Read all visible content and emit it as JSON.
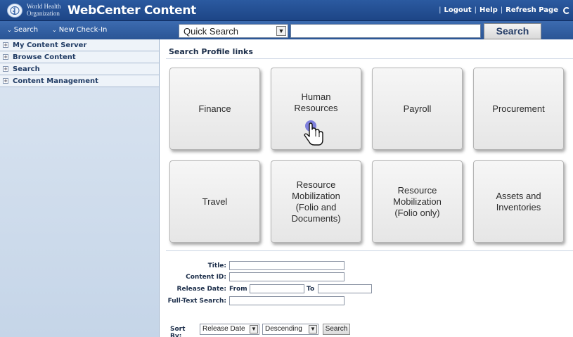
{
  "header": {
    "org_name": "World Health Organization",
    "app_title": "WebCenter Content",
    "links": [
      "Logout",
      "Help",
      "Refresh Page"
    ]
  },
  "toolbar": {
    "search_link": "Search",
    "new_checkin_link": "New Check-In",
    "quick_search_selected": "Quick Search",
    "search_input_value": "",
    "search_button": "Search"
  },
  "sidebar": {
    "items": [
      {
        "label": "My Content Server"
      },
      {
        "label": "Browse Content"
      },
      {
        "label": "Search"
      },
      {
        "label": "Content Management"
      }
    ]
  },
  "main": {
    "heading": "Search Profile links",
    "tiles": [
      {
        "lines": [
          "Finance"
        ]
      },
      {
        "lines": [
          "Human",
          "Resources"
        ]
      },
      {
        "lines": [
          "Payroll"
        ]
      },
      {
        "lines": [
          "Procurement"
        ]
      },
      {
        "lines": [
          "Travel"
        ]
      },
      {
        "lines": [
          "Resource",
          "Mobilization",
          "(Folio and",
          "Documents)"
        ]
      },
      {
        "lines": [
          "Resource",
          "Mobilization",
          "(Folio only)"
        ]
      },
      {
        "lines": [
          "Assets and",
          "Inventories"
        ]
      }
    ]
  },
  "form": {
    "title_label": "Title:",
    "content_id_label": "Content ID:",
    "release_date_label": "Release Date:",
    "from_label": "From",
    "to_label": "To",
    "fulltext_label": "Full-Text Search:",
    "sort_by_label": "Sort By:",
    "sort_field": "Release Date",
    "sort_order": "Descending",
    "search_button": "Search"
  },
  "colors": {
    "header_blue": "#1d4586",
    "sidebar_blue": "#c5d5e8",
    "tile_gray": "#e6e6e6"
  }
}
